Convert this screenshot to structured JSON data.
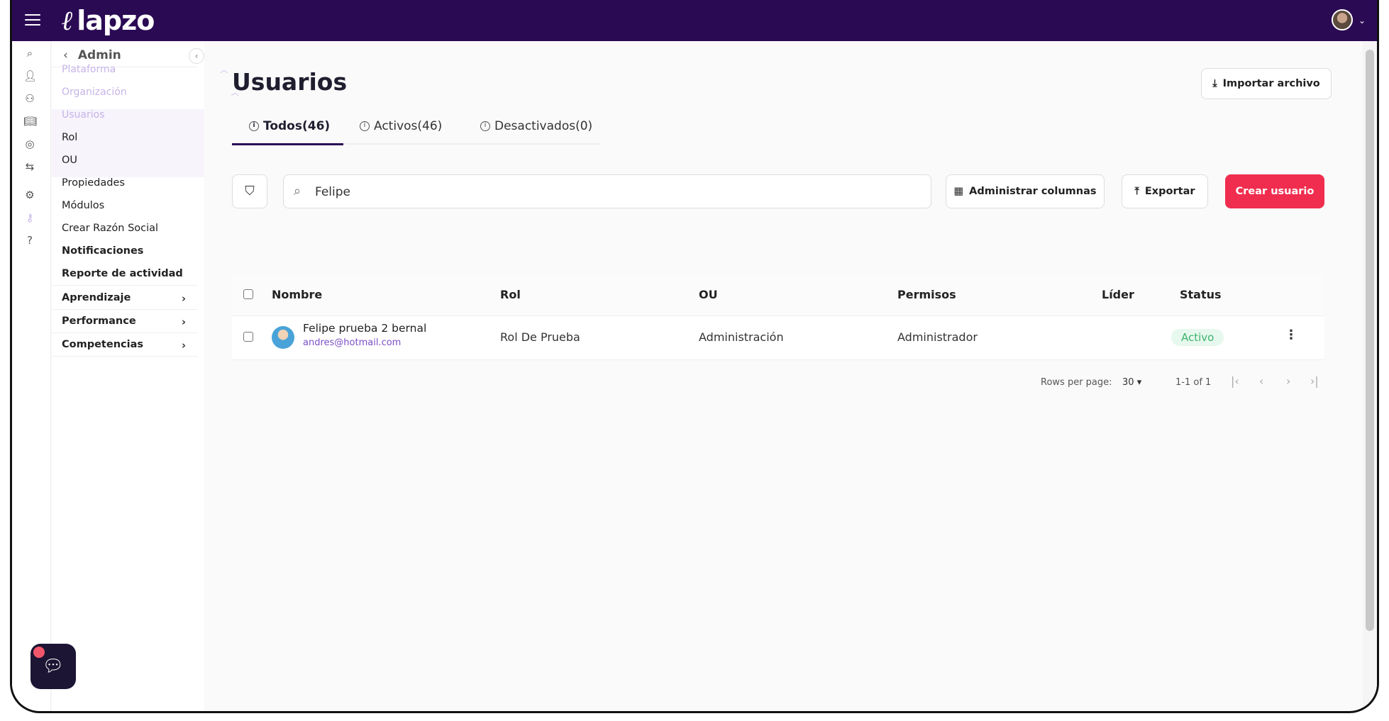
{
  "app": {
    "brand": "lapzo"
  },
  "sidebar": {
    "header": "Admin",
    "groups": [
      {
        "label": "Plataforma"
      },
      {
        "label": "Organización"
      }
    ],
    "selected": "Usuarios",
    "items": [
      {
        "label": "Rol"
      },
      {
        "label": "OU"
      },
      {
        "label": "Propiedades"
      },
      {
        "label": "Módulos"
      },
      {
        "label": "Crear Razón Social"
      },
      {
        "label": "Notificaciones"
      },
      {
        "label": "Reporte de actividad"
      }
    ],
    "sections": [
      {
        "label": "Aprendizaje"
      },
      {
        "label": "Performance"
      },
      {
        "label": "Competencias"
      }
    ]
  },
  "page": {
    "title": "Usuarios",
    "import_label": "Importar archivo"
  },
  "tabs": [
    {
      "label": "Todos(46)",
      "active": true
    },
    {
      "label": "Activos(46)"
    },
    {
      "label": "Desactivados(0)"
    }
  ],
  "toolbar": {
    "search_value": "Felipe",
    "columns_label": "Administrar columnas",
    "export_label": "Exportar",
    "create_label": "Crear usuario"
  },
  "table": {
    "headers": [
      "Nombre",
      "Rol",
      "OU",
      "Permisos",
      "Líder",
      "Status"
    ],
    "rows": [
      {
        "name": "Felipe prueba 2 bernal",
        "email": "andres@hotmail.com",
        "rol": "Rol De Prueba",
        "ou": "Administración",
        "permisos": "Administrador",
        "lider": "",
        "status": "Activo"
      }
    ]
  },
  "pagination": {
    "rows_per_page_label": "Rows per page:",
    "rows_per_page": "30",
    "range": "1-1 of 1"
  },
  "colors": {
    "topbar": "#2b0a54",
    "primary": "#f02d4e",
    "status_active": "#3bb56b"
  }
}
